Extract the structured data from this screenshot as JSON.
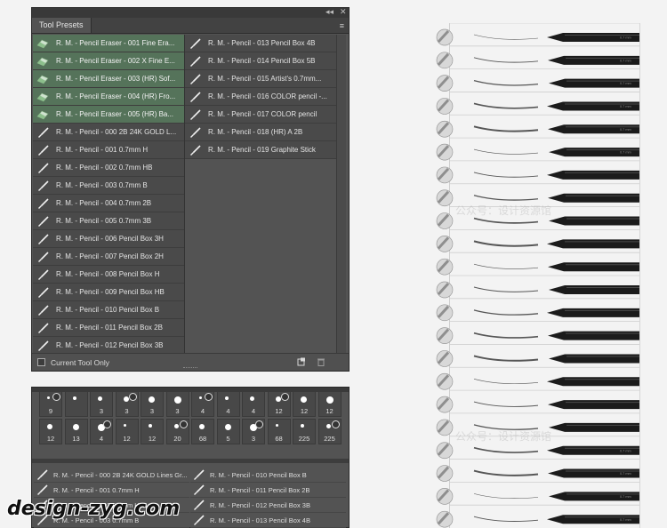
{
  "tool_presets": {
    "title": "Tool Presets",
    "collapse_glyph": "◂◂",
    "close_glyph": "✕",
    "menu_glyph": "≡",
    "footer_label": "Current Tool Only",
    "left_items": [
      {
        "label": "R. M. - Pencil Eraser - 001 Fine Era...",
        "selected": true,
        "icon": "eraser-icon"
      },
      {
        "label": "R. M. - Pencil Eraser - 002 X Fine E...",
        "selected": true,
        "icon": "eraser-icon"
      },
      {
        "label": "R. M. - Pencil Eraser - 003 (HR) Sof...",
        "selected": true,
        "icon": "eraser-icon"
      },
      {
        "label": "R. M. - Pencil Eraser - 004 (HR) Fro...",
        "selected": true,
        "icon": "eraser-icon"
      },
      {
        "label": "R. M. - Pencil Eraser - 005 (HR) Ba...",
        "selected": true,
        "icon": "eraser-icon"
      },
      {
        "label": "R. M. - Pencil - 000 2B 24K GOLD L...",
        "selected": false,
        "icon": "brush-icon"
      },
      {
        "label": "R. M. - Pencil - 001 0.7mm H",
        "selected": false,
        "icon": "brush-icon"
      },
      {
        "label": "R. M. - Pencil - 002 0.7mm HB",
        "selected": false,
        "icon": "brush-icon"
      },
      {
        "label": "R. M. - Pencil - 003 0.7mm B",
        "selected": false,
        "icon": "brush-icon"
      },
      {
        "label": "R. M. - Pencil - 004 0.7mm 2B",
        "selected": false,
        "icon": "brush-icon"
      },
      {
        "label": "R. M. - Pencil - 005 0.7mm 3B",
        "selected": false,
        "icon": "brush-icon"
      },
      {
        "label": "R. M. - Pencil - 006 Pencil Box 3H",
        "selected": false,
        "icon": "brush-icon"
      },
      {
        "label": "R. M. - Pencil - 007 Pencil Box 2H",
        "selected": false,
        "icon": "brush-icon"
      },
      {
        "label": "R. M. - Pencil - 008 Pencil Box H",
        "selected": false,
        "icon": "brush-icon"
      },
      {
        "label": "R. M. - Pencil - 009 Pencil Box HB",
        "selected": false,
        "icon": "brush-icon"
      },
      {
        "label": "R. M. - Pencil - 010 Pencil Box B",
        "selected": false,
        "icon": "brush-icon"
      },
      {
        "label": "R. M. - Pencil - 011 Pencil Box 2B",
        "selected": false,
        "icon": "brush-icon"
      },
      {
        "label": "R. M. - Pencil - 012 Pencil Box 3B",
        "selected": false,
        "icon": "brush-icon"
      }
    ],
    "right_items": [
      {
        "label": "R. M. - Pencil - 013 Pencil Box 4B",
        "icon": "brush-icon"
      },
      {
        "label": "R. M. - Pencil - 014 Pencil Box 5B",
        "icon": "brush-icon"
      },
      {
        "label": "R. M. - Pencil - 015 Artist's 0.7mm...",
        "icon": "brush-icon"
      },
      {
        "label": "R. M. - Pencil - 016 COLOR pencil -...",
        "icon": "brush-icon"
      },
      {
        "label": "R. M. - Pencil - 017 COLOR pencil",
        "icon": "brush-icon"
      },
      {
        "label": "R. M. - Pencil - 018 (HR) A 2B",
        "icon": "brush-icon"
      },
      {
        "label": "R. M. - Pencil - 019 Graphite Stick",
        "icon": "brush-icon"
      }
    ]
  },
  "brush_panel": {
    "tips_row1": [
      "9",
      "",
      "3",
      "3",
      "3",
      "3",
      "4",
      "4",
      "4",
      "12",
      "12",
      "12"
    ],
    "tips_row2": [
      "12",
      "13",
      "4",
      "12",
      "12",
      "20",
      "68",
      "5",
      "3",
      "68",
      "225",
      "225"
    ],
    "list": [
      {
        "label": "R. M. - Pencil - 000 2B 24K GOLD Lines Gr...",
        "col": 0
      },
      {
        "label": "R. M. - Pencil - 001 0.7mm H",
        "col": 0
      },
      {
        "label": "R. M. - Pencil - 002 0.7mm HB",
        "col": 0
      },
      {
        "label": "R. M. - Pencil - 003 0.7mm B",
        "col": 0
      },
      {
        "label": "R. M. - Pencil - 010 Pencil Box B",
        "col": 1
      },
      {
        "label": "R. M. - Pencil - 011 Pencil Box 2B",
        "col": 1
      },
      {
        "label": "R. M. - Pencil - 012 Pencil Box 3B",
        "col": 1
      },
      {
        "label": "R. M. - Pencil - 013 Pencil Box 4B",
        "col": 1
      }
    ]
  },
  "pencil_samples": {
    "count": 22,
    "pencil_label": "0.7 mm",
    "stroke_color": "#222222",
    "pencil_color": "#1b1b1b"
  },
  "watermark": {
    "site": "design-zyg.com",
    "text": "公众号：设计资源馆"
  }
}
